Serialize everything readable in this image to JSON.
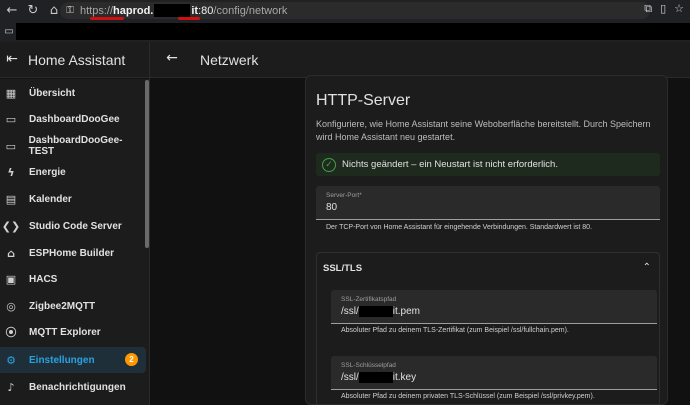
{
  "browser": {
    "url_scheme": "https://",
    "url_host": "haprod.",
    "url_host_suffix": "it",
    "url_port": ":80",
    "url_path": "/config/network"
  },
  "app": {
    "title": "Home Assistant"
  },
  "page": {
    "title": "Netzwerk"
  },
  "sidebar": {
    "items": [
      {
        "label": "Übersicht",
        "icon": "dashboard-grid-icon"
      },
      {
        "label": "DashboardDooGee",
        "icon": "dashboard-icon"
      },
      {
        "label": "DashboardDooGee-TEST",
        "icon": "dashboard-icon"
      },
      {
        "label": "Energie",
        "icon": "lightning-icon"
      },
      {
        "label": "Kalender",
        "icon": "calendar-icon"
      },
      {
        "label": "Studio Code Server",
        "icon": "vscode-icon"
      },
      {
        "label": "ESPHome Builder",
        "icon": "esphome-icon"
      },
      {
        "label": "HACS",
        "icon": "hacs-icon"
      },
      {
        "label": "Zigbee2MQTT",
        "icon": "zigbee-icon"
      },
      {
        "label": "MQTT Explorer",
        "icon": "radio-tower-icon"
      },
      {
        "label": "Einstellungen",
        "icon": "gear-icon",
        "badge": "2",
        "active": true
      },
      {
        "label": "Benachrichtigungen",
        "icon": "bell-icon"
      }
    ]
  },
  "card": {
    "title": "HTTP-Server",
    "description": "Konfiguriere, wie Home Assistant seine Weboberfläche bereitstellt. Durch Speichern wird Home Assistant neu gestartet.",
    "alert": "Nichts geändert – ein Neustart ist nicht erforderlich.",
    "server_port": {
      "label": "Server-Port*",
      "value": "80",
      "helper": "Der TCP-Port von Home Assistant für eingehende Verbindungen. Standardwert ist 80."
    },
    "ssl": {
      "title": "SSL/TLS",
      "cert": {
        "label": "SSL-Zertifikatspfad",
        "value_prefix": "/ssl/",
        "value_suffix": "it.pem",
        "helper": "Absoluter Pfad zu deinem TLS-Zertifikat (zum Beispiel /ssl/fullchain.pem)."
      },
      "key": {
        "label": "SSL-Schlüsselpfad",
        "value_prefix": "/ssl/",
        "value_suffix": "it.key",
        "helper": "Absoluter Pfad zu deinem privaten TLS-Schlüssel (zum Beispiel /ssl/privkey.pem)."
      }
    }
  },
  "colors": {
    "accent": "#29a3e0",
    "badge": "#ff9800",
    "success": "#43a047",
    "annotation": "#d01010"
  }
}
